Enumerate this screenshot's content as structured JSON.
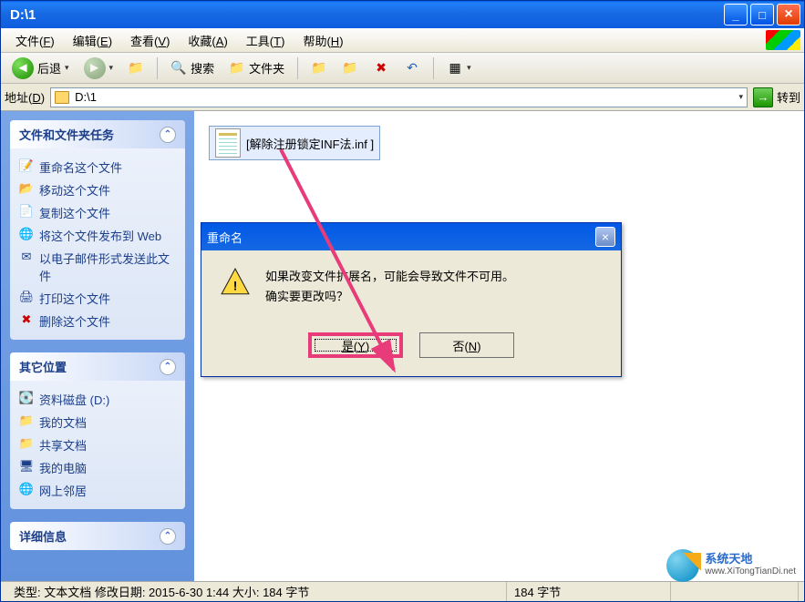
{
  "window": {
    "title": "D:\\1"
  },
  "menus": [
    {
      "label": "文件",
      "key": "F"
    },
    {
      "label": "编辑",
      "key": "E"
    },
    {
      "label": "查看",
      "key": "V"
    },
    {
      "label": "收藏",
      "key": "A"
    },
    {
      "label": "工具",
      "key": "T"
    },
    {
      "label": "帮助",
      "key": "H"
    }
  ],
  "toolbar": {
    "back": "后退",
    "search": "搜索",
    "folders": "文件夹"
  },
  "address": {
    "label": "地址",
    "key": "D",
    "value": "D:\\1",
    "go": "转到"
  },
  "sidebar": {
    "tasks": {
      "title": "文件和文件夹任务",
      "items": [
        "重命名这个文件",
        "移动这个文件",
        "复制这个文件",
        "将这个文件发布到 Web",
        "以电子邮件形式发送此文件",
        "打印这个文件",
        "删除这个文件"
      ]
    },
    "places": {
      "title": "其它位置",
      "items": [
        "资料磁盘 (D:)",
        "我的文档",
        "共享文档",
        "我的电脑",
        "网上邻居"
      ]
    },
    "details": {
      "title": "详细信息"
    }
  },
  "file": {
    "name": "[解除注册锁定INF法.inf ]"
  },
  "dialog": {
    "title": "重命名",
    "line1": "如果改变文件扩展名，可能会导致文件不可用。",
    "line2": "确实要更改吗？",
    "yes": "是(Y)",
    "no": "否(N)"
  },
  "status": {
    "left": "类型: 文本文档 修改日期: 2015-6-30 1:44 大小: 184 字节",
    "mid": "184 字节"
  },
  "watermark": {
    "name": "系统天地",
    "url": "www.XiTongTianDi.net"
  }
}
